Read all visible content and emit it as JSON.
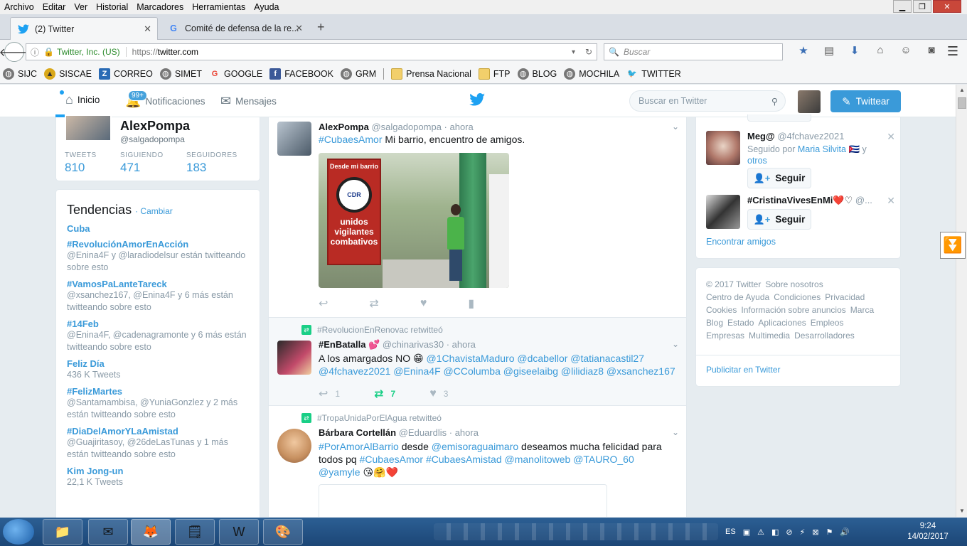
{
  "browser": {
    "menu": [
      "Archivo",
      "Editar",
      "Ver",
      "Historial",
      "Marcadores",
      "Herramientas",
      "Ayuda"
    ],
    "tabs": [
      {
        "title": "(2) Twitter",
        "icon": "twitter-icon",
        "active": true
      },
      {
        "title": "Comité de defensa de la re...",
        "icon": "google-icon",
        "active": false
      }
    ],
    "url": {
      "org": "Twitter, Inc. (US)",
      "protocol": "https://",
      "host": "twitter.com"
    },
    "search_placeholder": "Buscar",
    "bookmarks": [
      {
        "label": "SIJC",
        "icon": "globe-icon"
      },
      {
        "label": "SISCAE",
        "icon": "siscae-icon"
      },
      {
        "label": "CORREO",
        "icon": "zimbra-icon"
      },
      {
        "label": "SIMET",
        "icon": "globe-icon"
      },
      {
        "label": "GOOGLE",
        "icon": "google-icon"
      },
      {
        "label": "FACEBOOK",
        "icon": "facebook-icon"
      },
      {
        "label": "GRM",
        "icon": "globe-icon"
      },
      {
        "label": "Prensa Nacional",
        "icon": "folder-icon"
      },
      {
        "label": "FTP",
        "icon": "folder-icon"
      },
      {
        "label": "BLOG",
        "icon": "globe-icon"
      },
      {
        "label": "MOCHILA",
        "icon": "globe-icon"
      },
      {
        "label": "TWITTER",
        "icon": "twitter-icon"
      }
    ]
  },
  "header": {
    "nav": {
      "home": "Inicio",
      "notifications": "Notificaciones",
      "messages": "Mensajes"
    },
    "notif_badge": "99+",
    "search_placeholder": "Buscar en Twitter",
    "tweet_button": "Twittear"
  },
  "profile": {
    "name": "AlexPompa",
    "handle": "@salgadopompa",
    "stats": [
      {
        "label": "TWEETS",
        "value": "810"
      },
      {
        "label": "SIGUIENDO",
        "value": "471"
      },
      {
        "label": "SEGUIDORES",
        "value": "183"
      }
    ]
  },
  "trends": {
    "title": "Tendencias",
    "change": "· Cambiar",
    "items": [
      {
        "name": "Cuba",
        "desc": ""
      },
      {
        "name": "#RevoluciónAmorEnAcción",
        "desc": "@Enina4F y @laradiodelsur están twitteando sobre esto"
      },
      {
        "name": "#VamosPaLanteTareck",
        "desc": "@xsanchez167, @Enina4F y 6 más están twitteando sobre esto"
      },
      {
        "name": "#14Feb",
        "desc": "@Enina4F, @cadenagramonte y 6 más están twitteando sobre esto"
      },
      {
        "name": "Feliz Día",
        "desc": "436 K Tweets"
      },
      {
        "name": "#FelizMartes",
        "desc": "@Santamambisa, @YuniaGonzlez y 2 más están twitteando sobre esto"
      },
      {
        "name": "#DiaDelAmorYLaAmistad",
        "desc": "@Guajiritasoy, @26deLasTunas y 1 más están twitteando sobre esto"
      },
      {
        "name": "Kim Jong-un",
        "desc": "22,1 K Tweets"
      }
    ]
  },
  "tweets": [
    {
      "author": "AlexPompa",
      "handle": "@salgadopompa",
      "time": "· ahora",
      "hashtag": "#CubaesAmor",
      "text": " Mi barrio, encuentro de amigos.",
      "image_banner": {
        "top": "Desde mi barrio",
        "emblem": "CDR",
        "bottom": "unidos vigilantes combativos"
      }
    },
    {
      "retweeted_by": "#RevolucionEnRenovac retwitteó",
      "author": "#EnBatalla 💕",
      "handle": "@chinarivas30",
      "time": "· ahora",
      "text_plain": "A los amargados NO 😁 ",
      "mentions": "@1ChavistaMaduro @dcabellor @tatianacastil27 @4fchavez2021 @Enina4F @CColumba @giseelaibg @lilidiaz8 @xsanchez167",
      "counts": {
        "reply": "1",
        "retweet": "7",
        "like": "3"
      }
    },
    {
      "retweeted_by": "#TropaUnidaPorElAgua retwitteó",
      "author": "Bárbara Cortellán",
      "handle": "@Eduardlis",
      "time": "· ahora",
      "seg1": "#PorAmorAlBarrio",
      "seg2": " desde ",
      "seg3": "@emisoraguaimaro",
      "seg4": " deseamos mucha felicidad para todos pq ",
      "seg5": "#CubaesAmor #CubaesAmistad @manolitoweb @TAURO_60 @yamyle",
      "seg6": " 😘🤗❤️"
    }
  ],
  "who_to_follow": {
    "items": [
      {
        "name": "Meg@",
        "handle": "@4fchavez2021",
        "sub_prefix": "Seguido por ",
        "sub_link": "Maria Silvita",
        "sub_suffix": " 🇨🇺 y",
        "sub_more": "otros",
        "follow": "Seguir"
      },
      {
        "name": "#CristinaVivesEnMi❤️♡",
        "handle": "@...",
        "follow": "Seguir"
      }
    ],
    "find_friends": "Encontrar amigos"
  },
  "footer": {
    "links": [
      "© 2017 Twitter",
      "Sobre nosotros",
      "Centro de Ayuda",
      "Condiciones",
      "Privacidad",
      "Cookies",
      "Información sobre anuncios",
      "Marca",
      "Blog",
      "Estado",
      "Aplicaciones",
      "Empleos",
      "Empresas",
      "Multimedia",
      "Desarrolladores"
    ],
    "promote": "Publicitar en Twitter"
  },
  "taskbar": {
    "lang": "ES",
    "time": "9:24",
    "date": "14/02/2017"
  },
  "colors": {
    "twitter_blue": "#1da1f2",
    "link": "#3a9ad9",
    "retweet_green": "#19cf86"
  }
}
